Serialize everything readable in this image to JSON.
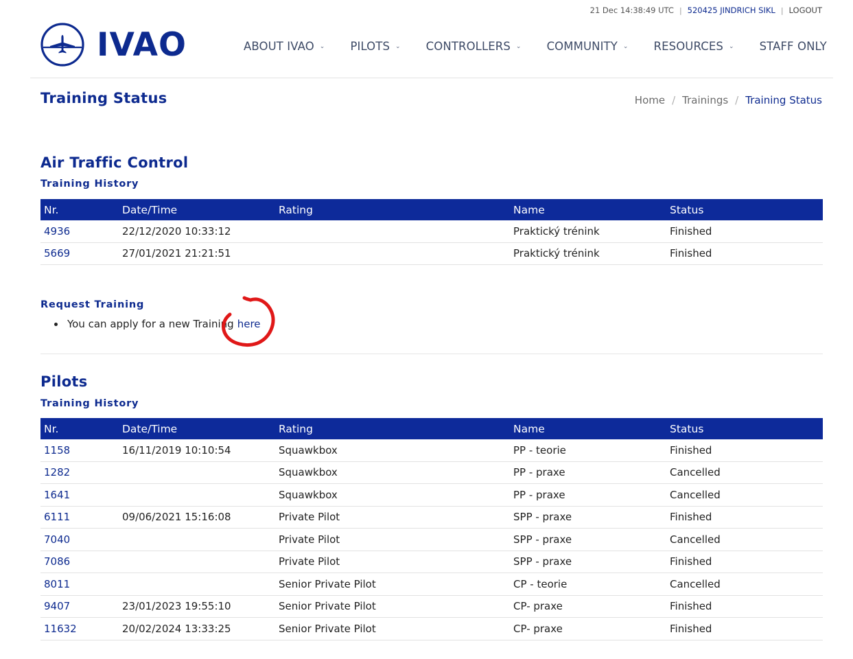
{
  "topbar": {
    "datetime": "21 Dec 14:38:49 UTC",
    "user": "520425 JINDRICH SIKL",
    "logout": "LOGOUT"
  },
  "logo": {
    "text": "IVAO"
  },
  "nav": [
    {
      "label": "ABOUT IVAO",
      "has_dropdown": true
    },
    {
      "label": "PILOTS",
      "has_dropdown": true
    },
    {
      "label": "CONTROLLERS",
      "has_dropdown": true
    },
    {
      "label": "COMMUNITY",
      "has_dropdown": true
    },
    {
      "label": "RESOURCES",
      "has_dropdown": true
    },
    {
      "label": "STAFF ONLY",
      "has_dropdown": false
    }
  ],
  "page": {
    "title": "Training Status",
    "breadcrumb": [
      "Home",
      "Trainings",
      "Training Status"
    ]
  },
  "atc": {
    "title": "Air Traffic Control",
    "history_title": "Training History",
    "columns": [
      "Nr.",
      "Date/Time",
      "Rating",
      "Name",
      "Status"
    ],
    "rows": [
      {
        "nr": "4936",
        "datetime": "22/12/2020 10:33:12",
        "rating": "",
        "name": "Praktický trénink",
        "status": "Finished"
      },
      {
        "nr": "5669",
        "datetime": "27/01/2021 21:21:51",
        "rating": "",
        "name": "Praktický trénink",
        "status": "Finished"
      }
    ],
    "request_title": "Request Training",
    "request_text": "You can apply for a new Training",
    "request_link": "here"
  },
  "pilots": {
    "title": "Pilots",
    "history_title": "Training History",
    "columns": [
      "Nr.",
      "Date/Time",
      "Rating",
      "Name",
      "Status"
    ],
    "rows": [
      {
        "nr": "1158",
        "datetime": "16/11/2019 10:10:54",
        "rating": "Squawkbox",
        "name": "PP - teorie",
        "status": "Finished"
      },
      {
        "nr": "1282",
        "datetime": "",
        "rating": "Squawkbox",
        "name": "PP - praxe",
        "status": "Cancelled"
      },
      {
        "nr": "1641",
        "datetime": "",
        "rating": "Squawkbox",
        "name": "PP - praxe",
        "status": "Cancelled"
      },
      {
        "nr": "6111",
        "datetime": "09/06/2021 15:16:08",
        "rating": "Private Pilot",
        "name": "SPP - praxe",
        "status": "Finished"
      },
      {
        "nr": "7040",
        "datetime": "",
        "rating": "Private Pilot",
        "name": "SPP - praxe",
        "status": "Cancelled"
      },
      {
        "nr": "7086",
        "datetime": "",
        "rating": "Private Pilot",
        "name": "SPP - praxe",
        "status": "Finished"
      },
      {
        "nr": "8011",
        "datetime": "",
        "rating": "Senior Private Pilot",
        "name": "CP - teorie",
        "status": "Cancelled"
      },
      {
        "nr": "9407",
        "datetime": "23/01/2023 19:55:10",
        "rating": "Senior Private Pilot",
        "name": "CP- praxe",
        "status": "Finished"
      },
      {
        "nr": "11632",
        "datetime": "20/02/2024 13:33:25",
        "rating": "Senior Private Pilot",
        "name": "CP- praxe",
        "status": "Finished"
      }
    ]
  },
  "colors": {
    "brand_blue": "#0d2a8f",
    "header_row": "#0d2a9a",
    "annotation_red": "#e01818"
  }
}
